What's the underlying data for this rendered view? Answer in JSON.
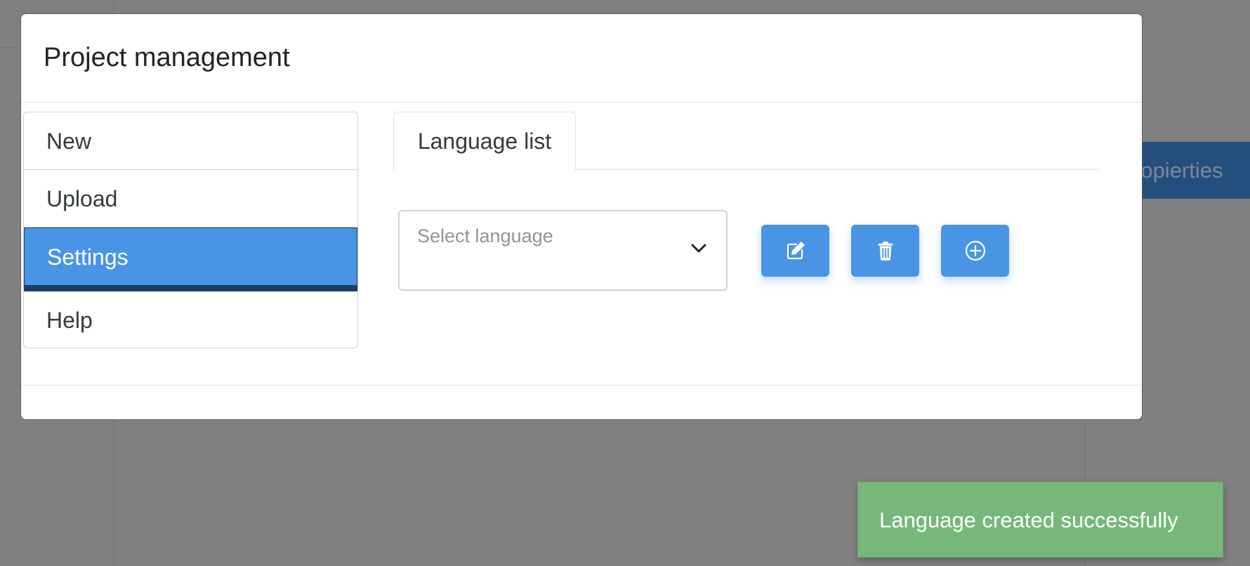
{
  "background": {
    "properties_button_label": "ropierties"
  },
  "modal": {
    "title": "Project management",
    "menu": {
      "items": [
        {
          "label": "New",
          "active": false
        },
        {
          "label": "Upload",
          "active": false
        },
        {
          "label": "Settings",
          "active": true
        },
        {
          "label": "Help",
          "active": false
        }
      ]
    },
    "tabs": [
      {
        "label": "Language list",
        "active": true
      }
    ],
    "language_select": {
      "placeholder": "Select language",
      "value": ""
    },
    "actions": {
      "edit_icon": "edit-icon",
      "delete_icon": "trash-icon",
      "add_icon": "plus-circle-icon"
    }
  },
  "toast": {
    "message": "Language created successfully",
    "type": "success"
  },
  "colors": {
    "primary": "#4a94e6",
    "active_border": "#1e3c62",
    "success": "#77b87a",
    "overlay": "#808080",
    "background_button": "#244e7d"
  }
}
